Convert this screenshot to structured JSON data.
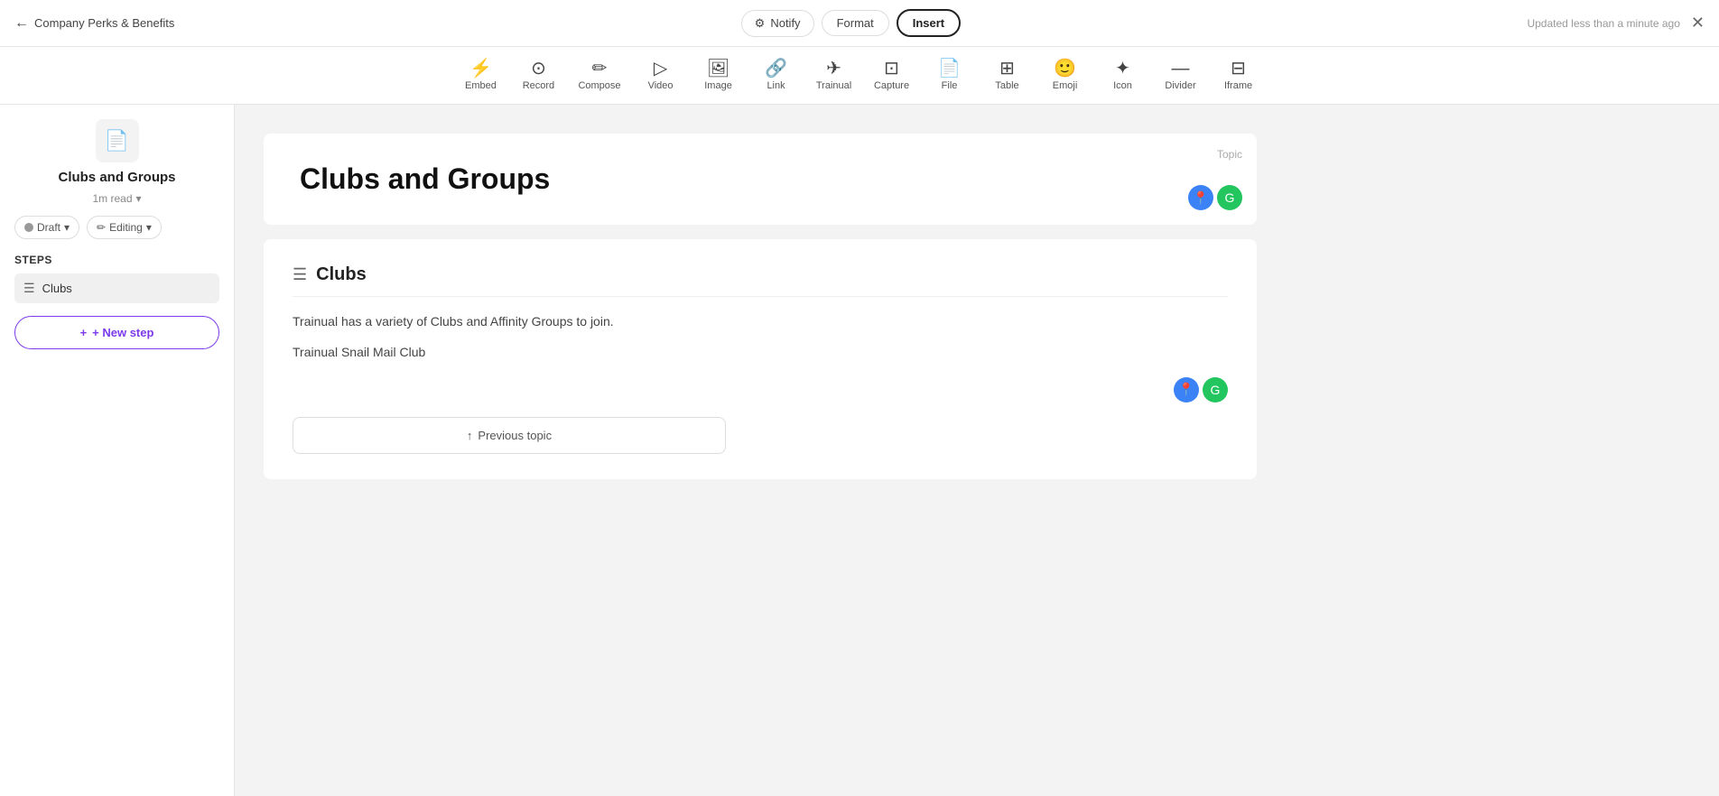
{
  "topbar": {
    "back_label": "Company Perks & Benefits",
    "notify_label": "Notify",
    "format_label": "Format",
    "insert_label": "Insert",
    "updated_text": "Updated less than a minute ago",
    "close_label": "✕"
  },
  "toolbar": {
    "items": [
      {
        "id": "embed",
        "label": "Embed",
        "icon": "⚡"
      },
      {
        "id": "record",
        "label": "Record",
        "icon": "⊙"
      },
      {
        "id": "compose",
        "label": "Compose",
        "icon": "✏"
      },
      {
        "id": "video",
        "label": "Video",
        "icon": "▷"
      },
      {
        "id": "image",
        "label": "Image",
        "icon": "🖼"
      },
      {
        "id": "link",
        "label": "Link",
        "icon": "🔗"
      },
      {
        "id": "trainual",
        "label": "Trainual",
        "icon": "✈"
      },
      {
        "id": "capture",
        "label": "Capture",
        "icon": "⊡"
      },
      {
        "id": "file",
        "label": "File",
        "icon": "📄"
      },
      {
        "id": "table",
        "label": "Table",
        "icon": "⊞"
      },
      {
        "id": "emoji",
        "label": "Emoji",
        "icon": "🙂"
      },
      {
        "id": "icon",
        "label": "Icon",
        "icon": "✦"
      },
      {
        "id": "divider",
        "label": "Divider",
        "icon": "—"
      },
      {
        "id": "iframe",
        "label": "Iframe",
        "icon": "⊟"
      }
    ]
  },
  "sidebar": {
    "doc_icon": "📄",
    "title": "Clubs and Groups",
    "read_label": "1m read",
    "draft_label": "Draft",
    "editing_label": "Editing",
    "steps_label": "Steps",
    "steps": [
      {
        "id": "clubs",
        "label": "Clubs"
      }
    ],
    "new_step_label": "+ New step"
  },
  "topic": {
    "topic_label": "Topic",
    "title": "Clubs and Groups",
    "avatar1": "📍",
    "avatar2": "G"
  },
  "step": {
    "title": "Clubs",
    "body_line1": "Trainual has a variety of Clubs and Affinity Groups to join.",
    "body_line2": "Trainual Snail Mail Club",
    "prev_topic_label": "↑ Previous topic"
  }
}
